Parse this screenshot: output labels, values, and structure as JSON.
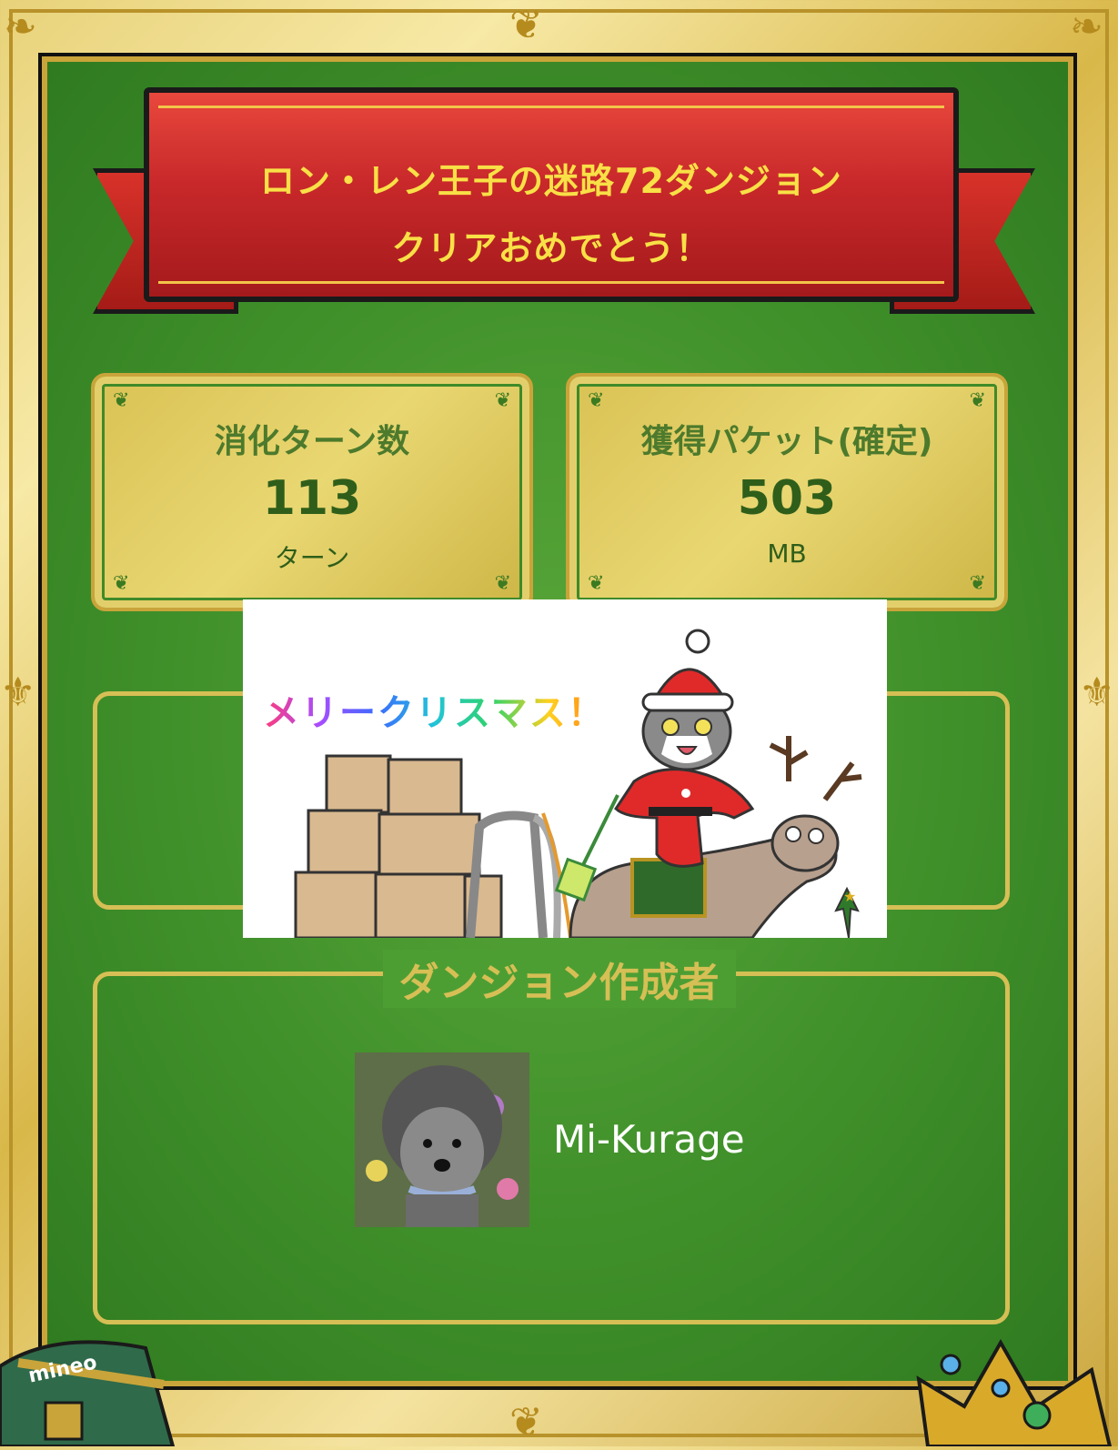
{
  "banner": {
    "line1": "ロン・レン王子の迷路72ダンジョン",
    "line2": "クリアおめでとう！"
  },
  "stats": {
    "turns": {
      "label": "消化ターン数",
      "value": "113",
      "unit": "ターン"
    },
    "packets": {
      "label": "獲得パケット(確定)",
      "value": "503",
      "unit": "MB"
    }
  },
  "illustration": {
    "caption": "メリークリスマス！"
  },
  "creator": {
    "section_title": "ダンジョン作成者",
    "name": "Mi-Kurage"
  },
  "decor": {
    "chest_label": "mineo"
  },
  "colors": {
    "board_green": "#3f8f2a",
    "gold": "#c9a43a",
    "ribbon_red": "#c8282a",
    "banner_text": "#f8e046"
  }
}
